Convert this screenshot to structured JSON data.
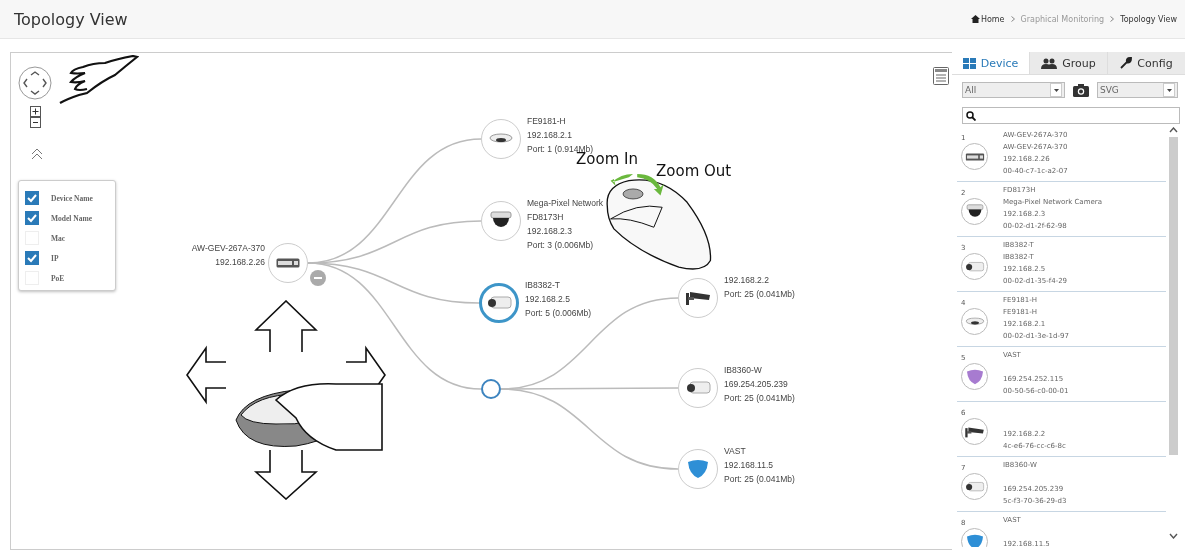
{
  "header": {
    "title": "Topology View",
    "breadcrumb": [
      {
        "label": "Home",
        "kind": "home"
      },
      {
        "label": "Graphical Monitoring",
        "kind": "link"
      },
      {
        "label": "Topology View",
        "kind": "current"
      }
    ]
  },
  "canvas": {
    "display_options": [
      {
        "label": "Device Name",
        "checked": true
      },
      {
        "label": "Model Name",
        "checked": true
      },
      {
        "label": "Mac",
        "checked": false
      },
      {
        "label": "IP",
        "checked": true
      },
      {
        "label": "PoE",
        "checked": false
      }
    ],
    "nodes": [
      {
        "kind": "switch",
        "lines": [
          "AW-GEV-267A-370",
          "192.168.2.26"
        ],
        "selected": false
      },
      {
        "kind": "fisheye",
        "lines": [
          "FE9181-H",
          "192.168.2.1",
          "Port: 1 (0.914Mb)"
        ],
        "selected": false
      },
      {
        "kind": "dome",
        "lines": [
          "Mega-Pixel Network",
          "FD8173H",
          "192.168.2.3",
          "Port: 3 (0.006Mb)"
        ],
        "selected": false
      },
      {
        "kind": "bullet",
        "lines": [
          "IB8382-T",
          "192.168.2.5",
          "Port: 5 (0.006Mb)"
        ],
        "selected": true
      },
      {
        "kind": "hub",
        "selected": true
      },
      {
        "kind": "box",
        "lines": [
          "192.168.2.2",
          "Port: 25 (0.041Mb)"
        ],
        "selected": false
      },
      {
        "kind": "bullet",
        "lines": [
          "IB8360-W",
          "169.254.205.239",
          "Port: 25 (0.041Mb)"
        ],
        "selected": false
      },
      {
        "kind": "vast",
        "color": "#2e8fd6",
        "lines": [
          "VAST",
          "192.168.11.5",
          "Port: 25 (0.041Mb)"
        ],
        "selected": false
      }
    ],
    "annotations": [
      {
        "kind": "zoom-in",
        "text": "Zoom In"
      },
      {
        "kind": "zoom-out",
        "text": "Zoom Out"
      }
    ]
  },
  "panel": {
    "tabs": [
      {
        "label": "Device",
        "kind": "device",
        "selected": true
      },
      {
        "label": "Group",
        "kind": "group",
        "selected": false
      },
      {
        "label": "Config",
        "kind": "config",
        "selected": false
      }
    ],
    "filter": {
      "value": "All"
    },
    "format": {
      "value": "SVG"
    },
    "devices": [
      {
        "number": "1",
        "kind": "switch",
        "name": "AW-GEV-267A-370",
        "model": "AW-GEV-267A-370",
        "ip": "192.168.2.26",
        "mac": "00-40-c7-1c-a2-07"
      },
      {
        "number": "2",
        "kind": "dome",
        "name": "FD8173H",
        "model": "Mega-Pixel Network Camera",
        "ip": "192.168.2.3",
        "mac": "00-02-d1-2f-62-98"
      },
      {
        "number": "3",
        "kind": "bullet",
        "name": "IB8382-T",
        "model": "IB8382-T",
        "ip": "192.168.2.5",
        "mac": "00-02-d1-35-f4-29"
      },
      {
        "number": "4",
        "kind": "fisheye",
        "name": "FE9181-H",
        "model": "FE9181-H",
        "ip": "192.168.2.1",
        "mac": "00-02-d1-3e-1d-97"
      },
      {
        "number": "5",
        "kind": "vast",
        "color": "#a77bd0",
        "name": "VAST",
        "ip": "169.254.252.115",
        "mac": "00-50-56-c0-00-01"
      },
      {
        "number": "6",
        "kind": "box",
        "ip": "192.168.2.2",
        "mac": "4c-e6-76-cc-c6-8c"
      },
      {
        "number": "7",
        "kind": "bullet",
        "name": "IB8360-W",
        "ip": "169.254.205.239",
        "mac": "5c-f3-70-36-29-d3"
      },
      {
        "number": "8",
        "kind": "vast",
        "color": "#2e8fd6",
        "name": "VAST",
        "ip": "192.168.11.5"
      }
    ]
  }
}
